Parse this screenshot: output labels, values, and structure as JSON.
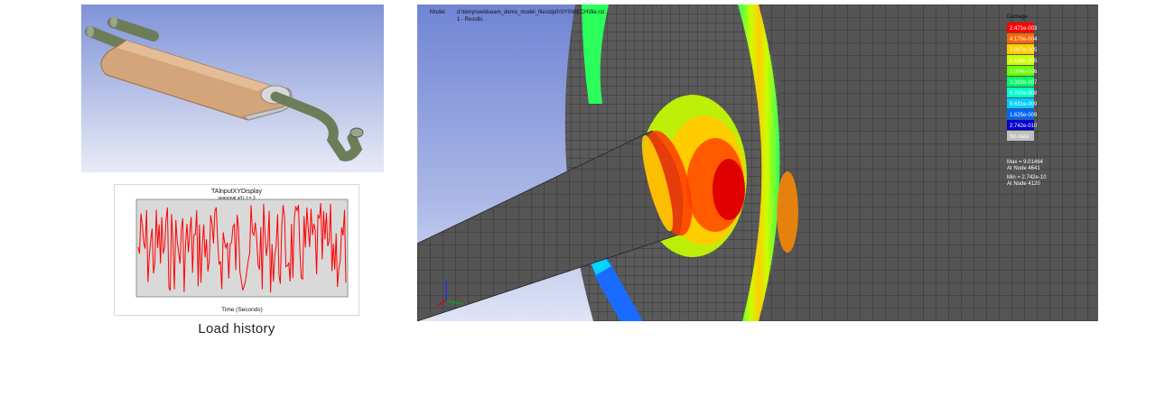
{
  "load_history": {
    "caption": "Load history",
    "chart_title": "TAlnputXYDisplay",
    "chart_subtitle": "seasonal x(t), t = 3",
    "xlabel": "Time (Seconds)",
    "line_color": "#ff0000",
    "plot_bg": "#d9d9d9"
  },
  "fea": {
    "model_label": "Model:",
    "model_path": "d:\\temp\\weldseam_demo_model_files\\dp0\\SYS\\MECH\\file.rst",
    "result_label": "1 - Results",
    "legend": {
      "title": "Damage",
      "colors": [
        "#ff0000",
        "#ff6600",
        "#ffcc00",
        "#ccff00",
        "#66ff00",
        "#00ff66",
        "#00ffcc",
        "#00ccff",
        "#0066ff",
        "#0000cc",
        "#c0c0c0"
      ],
      "labels": [
        "2.471e-003",
        "4.170e-004",
        "7.037e-005",
        "1.188e-005",
        "2.004e-006",
        "3.382e-007",
        "5.707e-008",
        "9.631e-009",
        "1.625e-009",
        "2.742e-010",
        "No data"
      ]
    },
    "max_text": "Max = 9.01464",
    "max_node": "At Node 4641",
    "min_text": "Min = 2.742e-10",
    "min_node": "At Node 4120"
  }
}
